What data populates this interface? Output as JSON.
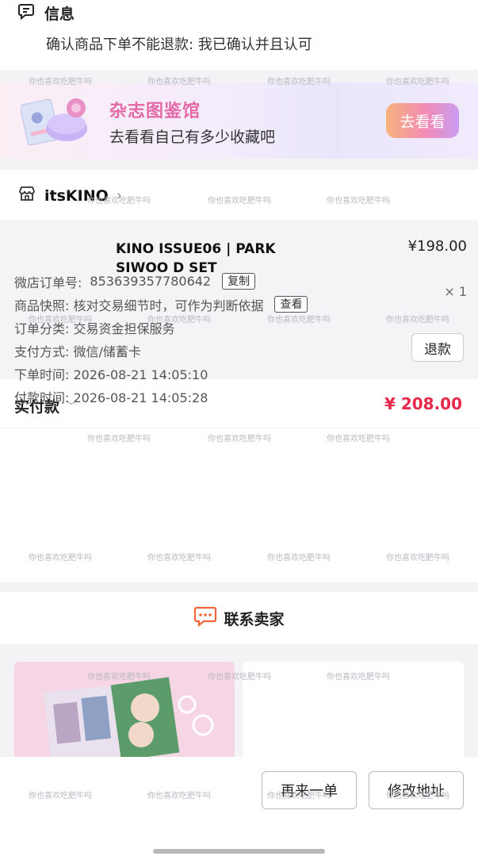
{
  "info": {
    "title": "信息",
    "text": "确认商品下单不能退款: 我已确认并且认可"
  },
  "banner": {
    "title": "杂志图鉴馆",
    "subtitle": "去看看自己有多少收藏吧",
    "button": "去看看"
  },
  "shop": {
    "name": "itsKINO",
    "chevron": "›"
  },
  "product": {
    "name": "KINO ISSUE06 | PARK SIWOO D SET",
    "price": "¥198.00",
    "qty": "× 1",
    "refund_button": "退款"
  },
  "payment": {
    "label": "实付款",
    "chevron": "﹀",
    "amount": "¥ 208.00"
  },
  "details": {
    "order_no_label": "微店订单号:",
    "order_no": "853639357780642",
    "copy_button": "复制",
    "snapshot": "商品快照: 核对交易细节时，可作为判断依据",
    "view_button": "查看",
    "category": "订单分类: 交易资金担保服务",
    "pay_method": "支付方式: 微信/储蓄卡",
    "order_time": "下单时间: 2026-08-21 14:05:10",
    "pay_time": "付款时间: 2026-08-21 14:05:28"
  },
  "contact": {
    "label": "联系卖家"
  },
  "bottom": {
    "reorder": "再来一单",
    "modify_address": "修改地址"
  },
  "watermark": "你也喜欢吃肥牛吗",
  "colors": {
    "price_red": "#e8284b",
    "banner_pink": "#e56aa8",
    "contact_icon": "#f0653a"
  }
}
